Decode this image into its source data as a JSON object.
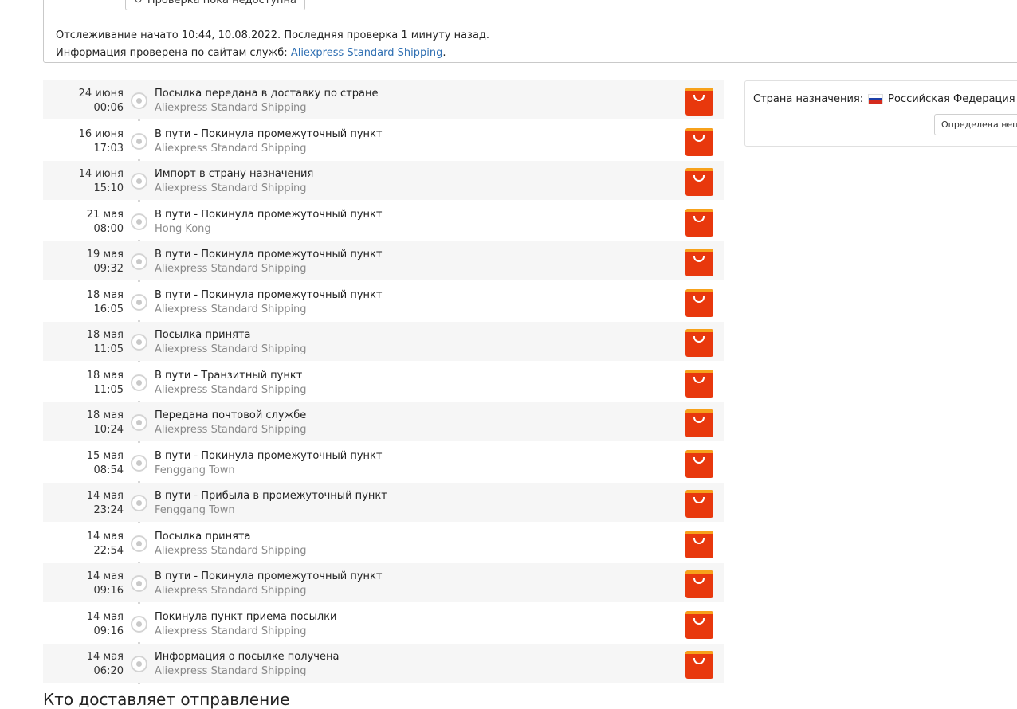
{
  "tracking_info": {
    "check_button_label": "Проверка пока недоступна",
    "started_text": "Отслеживание начато 10:44, 10.08.2022. Последняя проверка 1 минуту назад.",
    "sources_prefix": "Информация проверена по сайтам служб: ",
    "sources_link": "Aliexpress Standard Shipping",
    "sources_suffix": "."
  },
  "events": [
    {
      "date": "24 июня",
      "time": "00:06",
      "title": "Посылка передана в доставку по стране",
      "location": "Aliexpress Standard Shipping",
      "carrier_icon": "aliexpress-logo"
    },
    {
      "date": "16 июня",
      "time": "17:03",
      "title": "В пути - Покинула промежуточный пункт",
      "location": "Aliexpress Standard Shipping",
      "carrier_icon": "aliexpress-logo"
    },
    {
      "date": "14 июня",
      "time": "15:10",
      "title": "Импорт в страну назначения",
      "location": "Aliexpress Standard Shipping",
      "carrier_icon": "aliexpress-logo"
    },
    {
      "date": "21 мая",
      "time": "08:00",
      "title": "В пути - Покинула промежуточный пункт",
      "location": "Hong Kong",
      "carrier_icon": "aliexpress-logo"
    },
    {
      "date": "19 мая",
      "time": "09:32",
      "title": "В пути - Покинула промежуточный пункт",
      "location": "Aliexpress Standard Shipping",
      "carrier_icon": "aliexpress-logo"
    },
    {
      "date": "18 мая",
      "time": "16:05",
      "title": "В пути - Покинула промежуточный пункт",
      "location": "Aliexpress Standard Shipping",
      "carrier_icon": "aliexpress-logo"
    },
    {
      "date": "18 мая",
      "time": "11:05",
      "title": "Посылка принята",
      "location": "Aliexpress Standard Shipping",
      "carrier_icon": "aliexpress-logo"
    },
    {
      "date": "18 мая",
      "time": "11:05",
      "title": "В пути - Транзитный пункт",
      "location": "Aliexpress Standard Shipping",
      "carrier_icon": "aliexpress-logo"
    },
    {
      "date": "18 мая",
      "time": "10:24",
      "title": "Передана почтовой службе",
      "location": "Aliexpress Standard Shipping",
      "carrier_icon": "aliexpress-logo"
    },
    {
      "date": "15 мая",
      "time": "08:54",
      "title": "В пути - Покинула промежуточный пункт",
      "location": "Fenggang Town",
      "carrier_icon": "aliexpress-logo"
    },
    {
      "date": "14 мая",
      "time": "23:24",
      "title": "В пути - Прибыла в промежуточный пункт",
      "location": "Fenggang Town",
      "carrier_icon": "aliexpress-logo"
    },
    {
      "date": "14 мая",
      "time": "22:54",
      "title": "Посылка принята",
      "location": "Aliexpress Standard Shipping",
      "carrier_icon": "aliexpress-logo"
    },
    {
      "date": "14 мая",
      "time": "09:16",
      "title": "В пути - Покинула промежуточный пункт",
      "location": "Aliexpress Standard Shipping",
      "carrier_icon": "aliexpress-logo"
    },
    {
      "date": "14 мая",
      "time": "09:16",
      "title": "Покинула пункт приема посылки",
      "location": "Aliexpress Standard Shipping",
      "carrier_icon": "aliexpress-logo"
    },
    {
      "date": "14 мая",
      "time": "06:20",
      "title": "Информация о посылке получена",
      "location": "Aliexpress Standard Shipping",
      "carrier_icon": "aliexpress-logo"
    }
  ],
  "destination": {
    "label": "Страна назначения:",
    "country": "Российская Федерация",
    "flag_icon": "russia-flag",
    "detect_button": "Определена непр"
  },
  "bottom_heading": "Кто доставляет отправление",
  "colors": {
    "link": "#2f6fb2",
    "aliexpress_red": "#e8380d",
    "aliexpress_orange": "#f7a21b",
    "row_alt": "#f6f6f6"
  }
}
